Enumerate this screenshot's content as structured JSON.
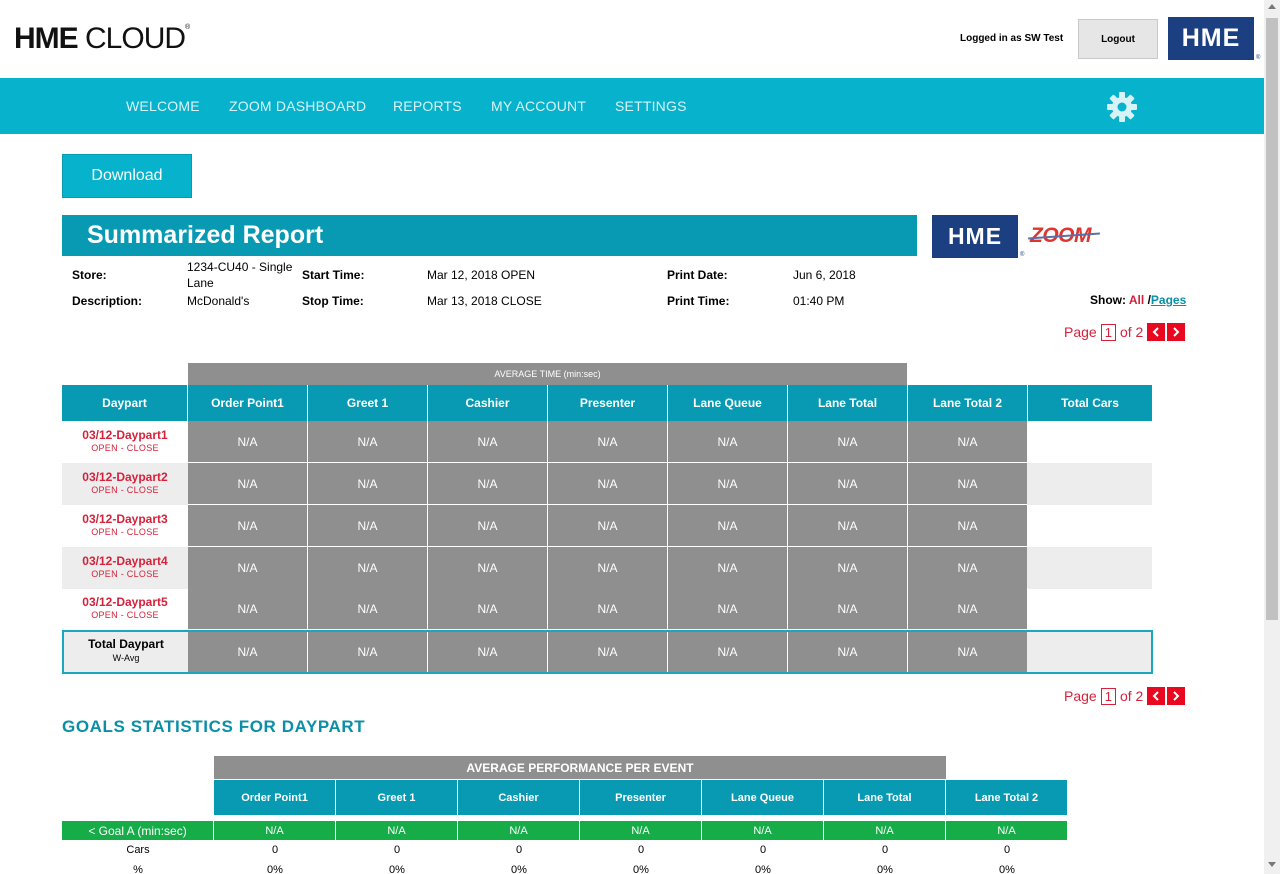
{
  "header": {
    "logo_bold": "HME",
    "logo_light": "CLOUD",
    "logo_reg": "®",
    "logged_in_text": "Logged in as  SW Test",
    "logout_label": "Logout",
    "brand_badge": "HME",
    "brand_reg": "®"
  },
  "nav": {
    "items": [
      "WELCOME",
      "ZOOM DASHBOARD",
      "REPORTS",
      "MY ACCOUNT",
      "SETTINGS"
    ],
    "settings_icon": "gear-icon"
  },
  "download_label": "Download",
  "report": {
    "title": "Summarized Report",
    "brand_badge": "HME",
    "brand_reg": "®",
    "zoom_logo": "ZOOM",
    "meta": {
      "store_label": "Store:",
      "store_value_line1": "1234-CU40 - Single",
      "store_value_line2": "Lane",
      "description_label": "Description:",
      "description_value": "McDonald's",
      "start_label": "Start Time:",
      "start_value": "Mar 12, 2018 OPEN",
      "stop_label": "Stop Time:",
      "stop_value": "Mar 13, 2018 CLOSE",
      "print_date_label": "Print Date:",
      "print_date_value": "Jun 6, 2018",
      "print_time_label": "Print Time:",
      "print_time_value": "01:40 PM"
    },
    "show": {
      "label": "Show:",
      "all": "All",
      "sep": "/",
      "pages": "Pages"
    },
    "pager": {
      "page_label": "Page",
      "current": "1",
      "of_label": "of 2"
    },
    "avg_header": "AVERAGE TIME (min:sec)",
    "columns": [
      "Daypart",
      "Order Point1",
      "Greet 1",
      "Cashier",
      "Presenter",
      "Lane Queue",
      "Lane Total",
      "Lane Total 2",
      "Total Cars"
    ],
    "rows": [
      {
        "daypart": "03/12-Daypart1",
        "range": "OPEN - CLOSE",
        "values": [
          "N/A",
          "N/A",
          "N/A",
          "N/A",
          "N/A",
          "N/A",
          "N/A"
        ],
        "cars": ""
      },
      {
        "daypart": "03/12-Daypart2",
        "range": "OPEN - CLOSE",
        "values": [
          "N/A",
          "N/A",
          "N/A",
          "N/A",
          "N/A",
          "N/A",
          "N/A"
        ],
        "cars": ""
      },
      {
        "daypart": "03/12-Daypart3",
        "range": "OPEN - CLOSE",
        "values": [
          "N/A",
          "N/A",
          "N/A",
          "N/A",
          "N/A",
          "N/A",
          "N/A"
        ],
        "cars": ""
      },
      {
        "daypart": "03/12-Daypart4",
        "range": "OPEN - CLOSE",
        "values": [
          "N/A",
          "N/A",
          "N/A",
          "N/A",
          "N/A",
          "N/A",
          "N/A"
        ],
        "cars": ""
      },
      {
        "daypart": "03/12-Daypart5",
        "range": "OPEN - CLOSE",
        "values": [
          "N/A",
          "N/A",
          "N/A",
          "N/A",
          "N/A",
          "N/A",
          "N/A"
        ],
        "cars": ""
      }
    ],
    "total_row": {
      "label": "Total Daypart",
      "sub": "W-Avg",
      "values": [
        "N/A",
        "N/A",
        "N/A",
        "N/A",
        "N/A",
        "N/A",
        "N/A"
      ],
      "cars": ""
    }
  },
  "goals": {
    "title": "GOALS STATISTICS FOR DAYPART",
    "perf_header": "AVERAGE PERFORMANCE PER EVENT",
    "columns": [
      "Order Point1",
      "Greet 1",
      "Cashier",
      "Presenter",
      "Lane Queue",
      "Lane Total",
      "Lane Total 2"
    ],
    "goal_label": "< Goal A (min:sec)",
    "goal_values": [
      "N/A",
      "N/A",
      "N/A",
      "N/A",
      "N/A",
      "N/A",
      "N/A"
    ],
    "cars_label": "Cars",
    "cars_values": [
      "0",
      "0",
      "0",
      "0",
      "0",
      "0",
      "0"
    ],
    "pct_label": "%",
    "pct_values": [
      "0%",
      "0%",
      "0%",
      "0%",
      "0%",
      "0%",
      "0%"
    ]
  },
  "colors": {
    "teal": "#07b2cc",
    "dark_teal": "#0899b3",
    "brand_navy": "#1b3f80",
    "red": "#d6213b",
    "green": "#16ad48",
    "grey_cell": "#8f8f8f"
  }
}
